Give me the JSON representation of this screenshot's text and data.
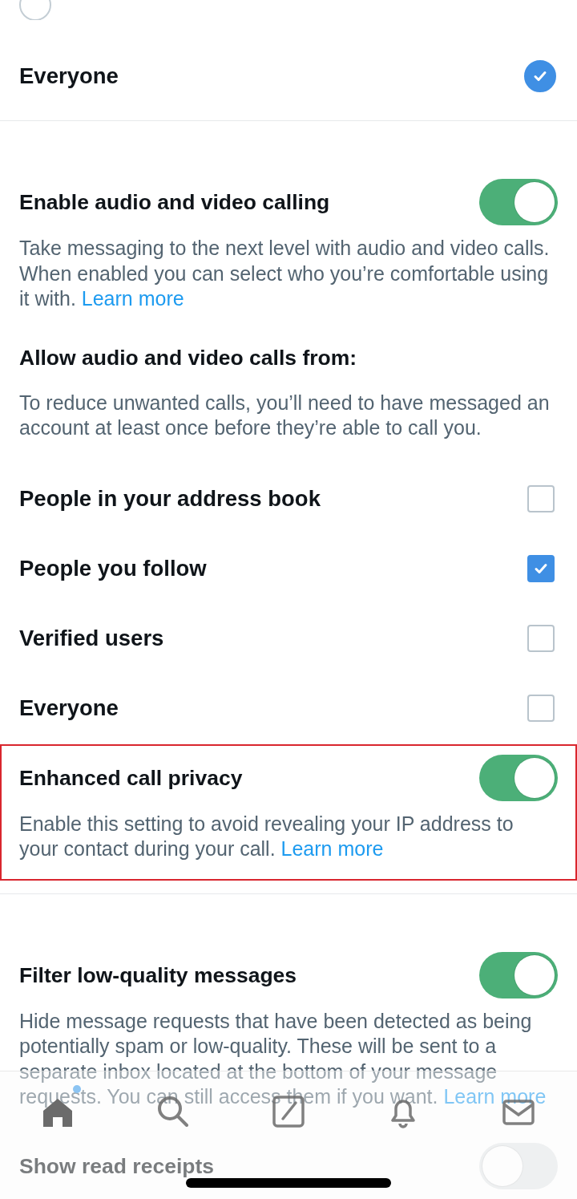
{
  "message_options": [
    {
      "selected": false
    },
    {
      "label": "Everyone",
      "selected": true
    }
  ],
  "settings": [
    {
      "kind": "toggle",
      "title": "Enable audio and video calling",
      "on": true,
      "description": "Take messaging to the next level with audio and video calls. When enabled you can select who you’re comfortable using it with.",
      "link": "Learn more"
    },
    {
      "kind": "heading",
      "title": "Allow audio and video calls from:",
      "description": "To reduce unwanted calls, you’ll need to have messaged an account at least once before they’re able to call you."
    },
    {
      "kind": "checkbox",
      "label": "People in your address book",
      "checked": false
    },
    {
      "kind": "checkbox",
      "label": "People you follow",
      "checked": true
    },
    {
      "kind": "checkbox",
      "label": "Verified users",
      "checked": false
    },
    {
      "kind": "checkbox",
      "label": "Everyone",
      "checked": false
    },
    {
      "kind": "toggle",
      "title": "Enhanced call privacy",
      "on": true,
      "description": "Enable this setting to avoid revealing your IP address to your contact during your call.",
      "link": "Learn more",
      "highlighted": true
    },
    {
      "kind": "divider"
    },
    {
      "kind": "toggle",
      "title": "Filter low-quality messages",
      "on": true,
      "description": "Hide message requests that have been detected as being potentially spam or low-quality. These will be sent to a separate inbox located at the bottom of your message requests. You can still access them if you want.",
      "link": "Learn more"
    },
    {
      "kind": "toggle",
      "title": "Show read receipts",
      "on": false
    }
  ],
  "tab_bar": {
    "tabs": [
      {
        "selected": true,
        "badge": true
      },
      {
        "selected": false
      },
      {
        "selected": false
      },
      {
        "selected": false
      },
      {
        "selected": false
      }
    ]
  }
}
